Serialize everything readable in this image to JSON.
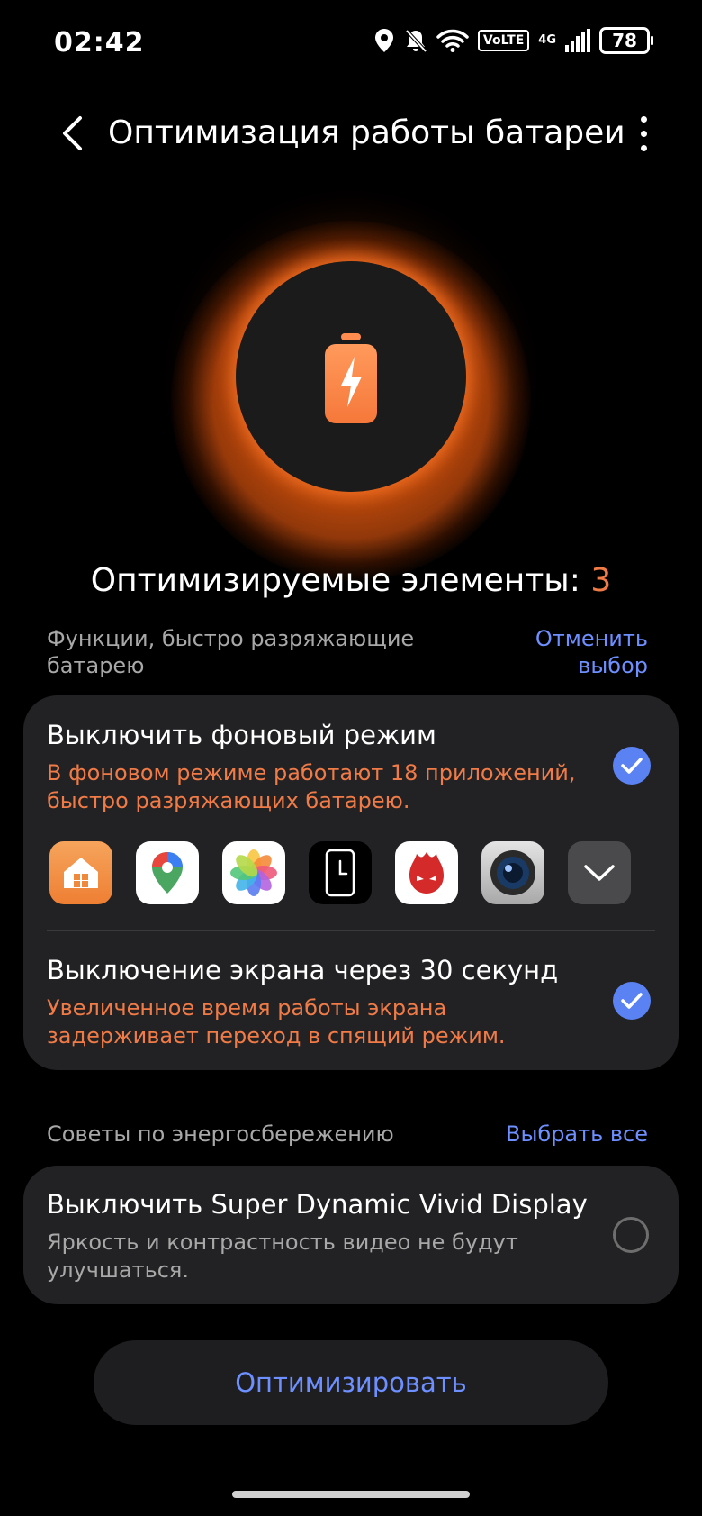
{
  "status_bar": {
    "time": "02:42",
    "volte": "VoLTE",
    "network": "4G",
    "battery_level": "78"
  },
  "header": {
    "title": "Оптимизация работы батареи"
  },
  "summary": {
    "label": "Оптимизируемые элементы: ",
    "count": "3"
  },
  "section_battery": {
    "label": "Функции, быстро разряжающие батарею",
    "action": "Отменить выбор",
    "items": [
      {
        "title": "Выключить фоновый режим",
        "description": "В фоновом режиме работают 18 приложений, быстро разряжающих батарею.",
        "checked": true
      },
      {
        "title": "Выключение экрана через 30 секунд",
        "description": "Увеличенное время работы экрана задерживает переход в спящий режим.",
        "checked": true
      }
    ],
    "apps": [
      "home-app-icon",
      "maps-app-icon",
      "photos-app-icon",
      "clock-app-icon",
      "antutu-app-icon",
      "camera-app-icon",
      "expand-apps-icon"
    ]
  },
  "section_tips": {
    "label": "Советы по энергосбережению",
    "action": "Выбрать все",
    "items": [
      {
        "title": "Выключить Super Dynamic Vivid Display",
        "description": "Яркость и контрастность видео не будут улучшаться.",
        "checked": false
      }
    ]
  },
  "optimize_button": "Оптимизировать",
  "colors": {
    "accent_blue": "#5a82f2",
    "link_blue": "#6d8fff",
    "warning_orange": "#f07b47",
    "card_bg": "#222224"
  }
}
